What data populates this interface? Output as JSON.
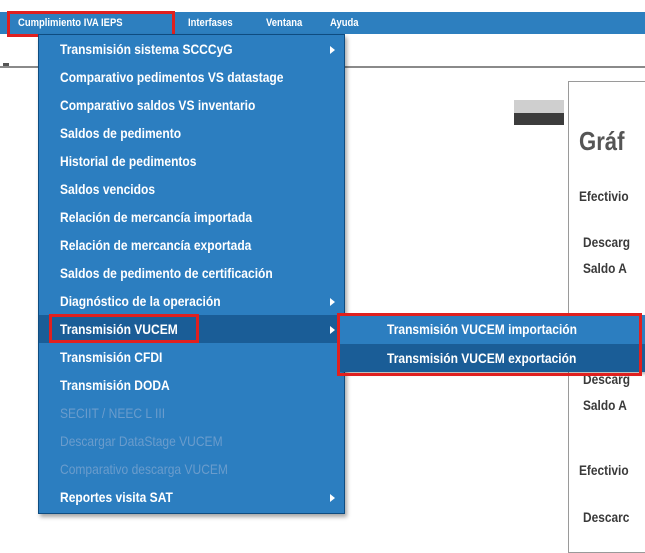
{
  "menubar": {
    "items": [
      "Cumplimiento IVA IEPS",
      "Interfases",
      "Ventana",
      "Ayuda"
    ]
  },
  "dropdown": {
    "items": [
      {
        "label": "Transmisión sistema SCCCyG",
        "submenu": true,
        "disabled": false
      },
      {
        "label": "Comparativo pedimentos VS datastage",
        "submenu": false,
        "disabled": false
      },
      {
        "label": "Comparativo saldos VS inventario",
        "submenu": false,
        "disabled": false
      },
      {
        "label": "Saldos de pedimento",
        "submenu": false,
        "disabled": false
      },
      {
        "label": "Historial de pedimentos",
        "submenu": false,
        "disabled": false
      },
      {
        "label": "Saldos vencidos",
        "submenu": false,
        "disabled": false
      },
      {
        "label": "Relación de mercancía importada",
        "submenu": false,
        "disabled": false
      },
      {
        "label": "Relación de mercancía exportada",
        "submenu": false,
        "disabled": false
      },
      {
        "label": "Saldos de pedimento de certificación",
        "submenu": false,
        "disabled": false
      },
      {
        "label": "Diagnóstico de la operación",
        "submenu": true,
        "disabled": false
      },
      {
        "label": "Transmisión VUCEM",
        "submenu": true,
        "disabled": false
      },
      {
        "label": "Transmisión CFDI",
        "submenu": false,
        "disabled": false
      },
      {
        "label": "Transmisión DODA",
        "submenu": false,
        "disabled": false
      },
      {
        "label": "SECIIT / NEEC L III",
        "submenu": false,
        "disabled": true
      },
      {
        "label": "Descargar DataStage VUCEM",
        "submenu": false,
        "disabled": true
      },
      {
        "label": "Comparativo descarga VUCEM",
        "submenu": false,
        "disabled": true
      },
      {
        "label": "Reportes visita SAT",
        "submenu": true,
        "disabled": false
      }
    ]
  },
  "submenu": {
    "items": [
      "Transmisión VUCEM importación",
      "Transmisión VUCEM exportación"
    ]
  },
  "document": {
    "title": "Gráf",
    "lines": [
      "Efectivio",
      "Descarg",
      "Saldo A",
      "Descarg",
      "Saldo A",
      "Efectivio",
      "Descarc"
    ]
  },
  "colors": {
    "menu_bg": "#2c7ec0",
    "menu_active": "#1a5d97",
    "highlight_box": "#e0201f",
    "disabled_text": "#6a9ccc"
  }
}
